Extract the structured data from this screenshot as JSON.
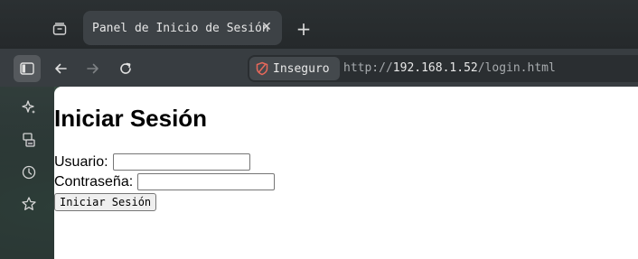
{
  "browser": {
    "tab": {
      "title": "Panel de Inicio de Sesión",
      "close_glyph": "✕"
    },
    "new_tab_glyph": "+",
    "urlbar": {
      "security_label": "Inseguro",
      "url_scheme": "http://",
      "url_host": "192.168.1.52",
      "url_path": "/login.html"
    },
    "icons": {
      "tab_list": "tab-list-icon",
      "sidebar": "sidebar-toggle-icon",
      "back": "back-arrow-icon",
      "forward": "forward-arrow-icon",
      "reload": "reload-icon",
      "insecure": "shield-warning-icon",
      "side_panel": [
        "sparkle-icon",
        "synced-tabs-icon",
        "history-icon",
        "bookmark-star-icon"
      ]
    },
    "colors": {
      "insecure_accent": "#e8685a",
      "accent": "#ffffff"
    }
  },
  "page": {
    "heading": "Iniciar Sesión",
    "username_label": "Usuario:",
    "username_value": "",
    "password_label": "Contraseña:",
    "password_value": "",
    "submit_label": "Iniciar Sesión"
  }
}
